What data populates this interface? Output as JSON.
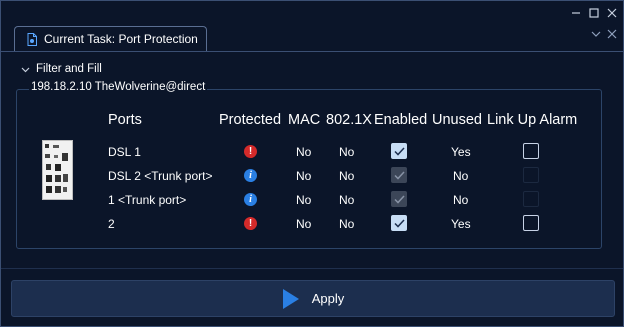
{
  "tab": {
    "title": "Current Task: Port Protection"
  },
  "section": {
    "title": "Filter and Fill"
  },
  "device": {
    "label": "198.18.2.10 TheWolverine@direct"
  },
  "table": {
    "headers": {
      "ports": "Ports",
      "protected": "Protected",
      "mac": "MAC",
      "dot1x": "802.1X",
      "enabled": "Enabled",
      "unused": "Unused",
      "link_up_alarm": "Link Up Alarm"
    },
    "rows": [
      {
        "port": "DSL 1",
        "protected_icon": "error-icon",
        "mac": "No",
        "dot1x": "No",
        "enabled": true,
        "enabled_disabled": false,
        "unused": "Yes",
        "alarm": false,
        "alarm_disabled": false
      },
      {
        "port": "DSL 2  <Trunk port>",
        "protected_icon": "info-icon",
        "mac": "No",
        "dot1x": "No",
        "enabled": true,
        "enabled_disabled": true,
        "unused": "No",
        "alarm": false,
        "alarm_disabled": true
      },
      {
        "port": "1 <Trunk port>",
        "protected_icon": "info-icon",
        "mac": "No",
        "dot1x": "No",
        "enabled": true,
        "enabled_disabled": true,
        "unused": "No",
        "alarm": false,
        "alarm_disabled": true
      },
      {
        "port": "2",
        "protected_icon": "error-icon",
        "mac": "No",
        "dot1x": "No",
        "enabled": true,
        "enabled_disabled": false,
        "unused": "Yes",
        "alarm": false,
        "alarm_disabled": false
      }
    ]
  },
  "footer": {
    "apply_label": "Apply"
  },
  "colors": {
    "background": "#0b1529",
    "accent": "#2a7fe3",
    "error": "#d42a2a",
    "button": "#1c2e4e"
  }
}
